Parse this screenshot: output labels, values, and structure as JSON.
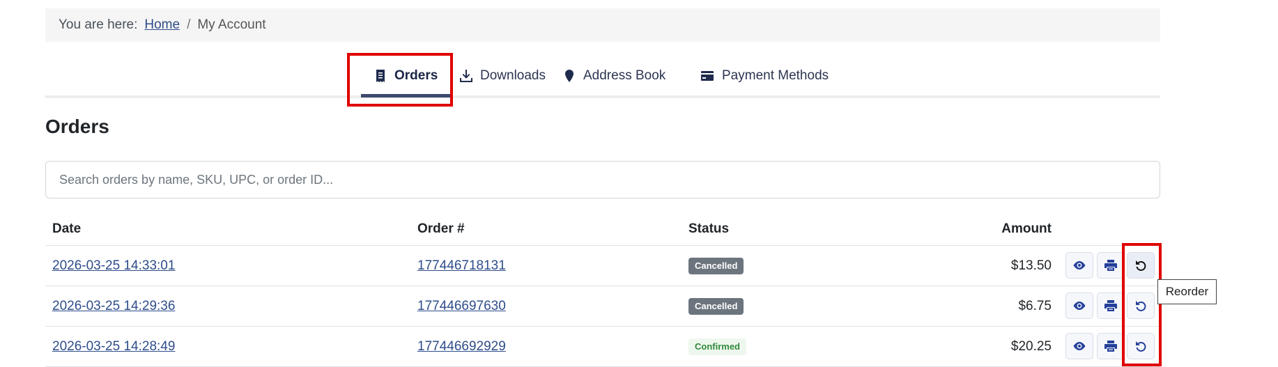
{
  "breadcrumb": {
    "prefix": "You are here:",
    "home": "Home",
    "separator": "/",
    "current": "My Account"
  },
  "tabs": [
    {
      "label": "Orders",
      "icon": "receipt-icon",
      "active": true
    },
    {
      "label": "Downloads",
      "icon": "download-icon",
      "active": false
    },
    {
      "label": "Address Book",
      "icon": "map-marker-icon",
      "active": false
    },
    {
      "label": "Payment Methods",
      "icon": "credit-card-icon",
      "active": false
    }
  ],
  "page": {
    "title": "Orders"
  },
  "search": {
    "placeholder": "Search orders by name, SKU, UPC, or order ID...",
    "value": ""
  },
  "table": {
    "headers": {
      "date": "Date",
      "order": "Order #",
      "status": "Status",
      "amount": "Amount"
    },
    "rows": [
      {
        "date": "2026-03-25 14:33:01",
        "order": "177446718131",
        "status": "Cancelled",
        "amount": "$13.50"
      },
      {
        "date": "2026-03-25 14:29:36",
        "order": "177446697630",
        "status": "Cancelled",
        "amount": "$6.75"
      },
      {
        "date": "2026-03-25 14:28:49",
        "order": "177446692929",
        "status": "Confirmed",
        "amount": "$20.25"
      }
    ]
  },
  "tooltip": {
    "text": "Reorder"
  },
  "colors": {
    "accent": "#2e4c8a",
    "highlight": "#e00000",
    "cancelled": "#6c757d",
    "confirmed": "#2f8a3a"
  }
}
